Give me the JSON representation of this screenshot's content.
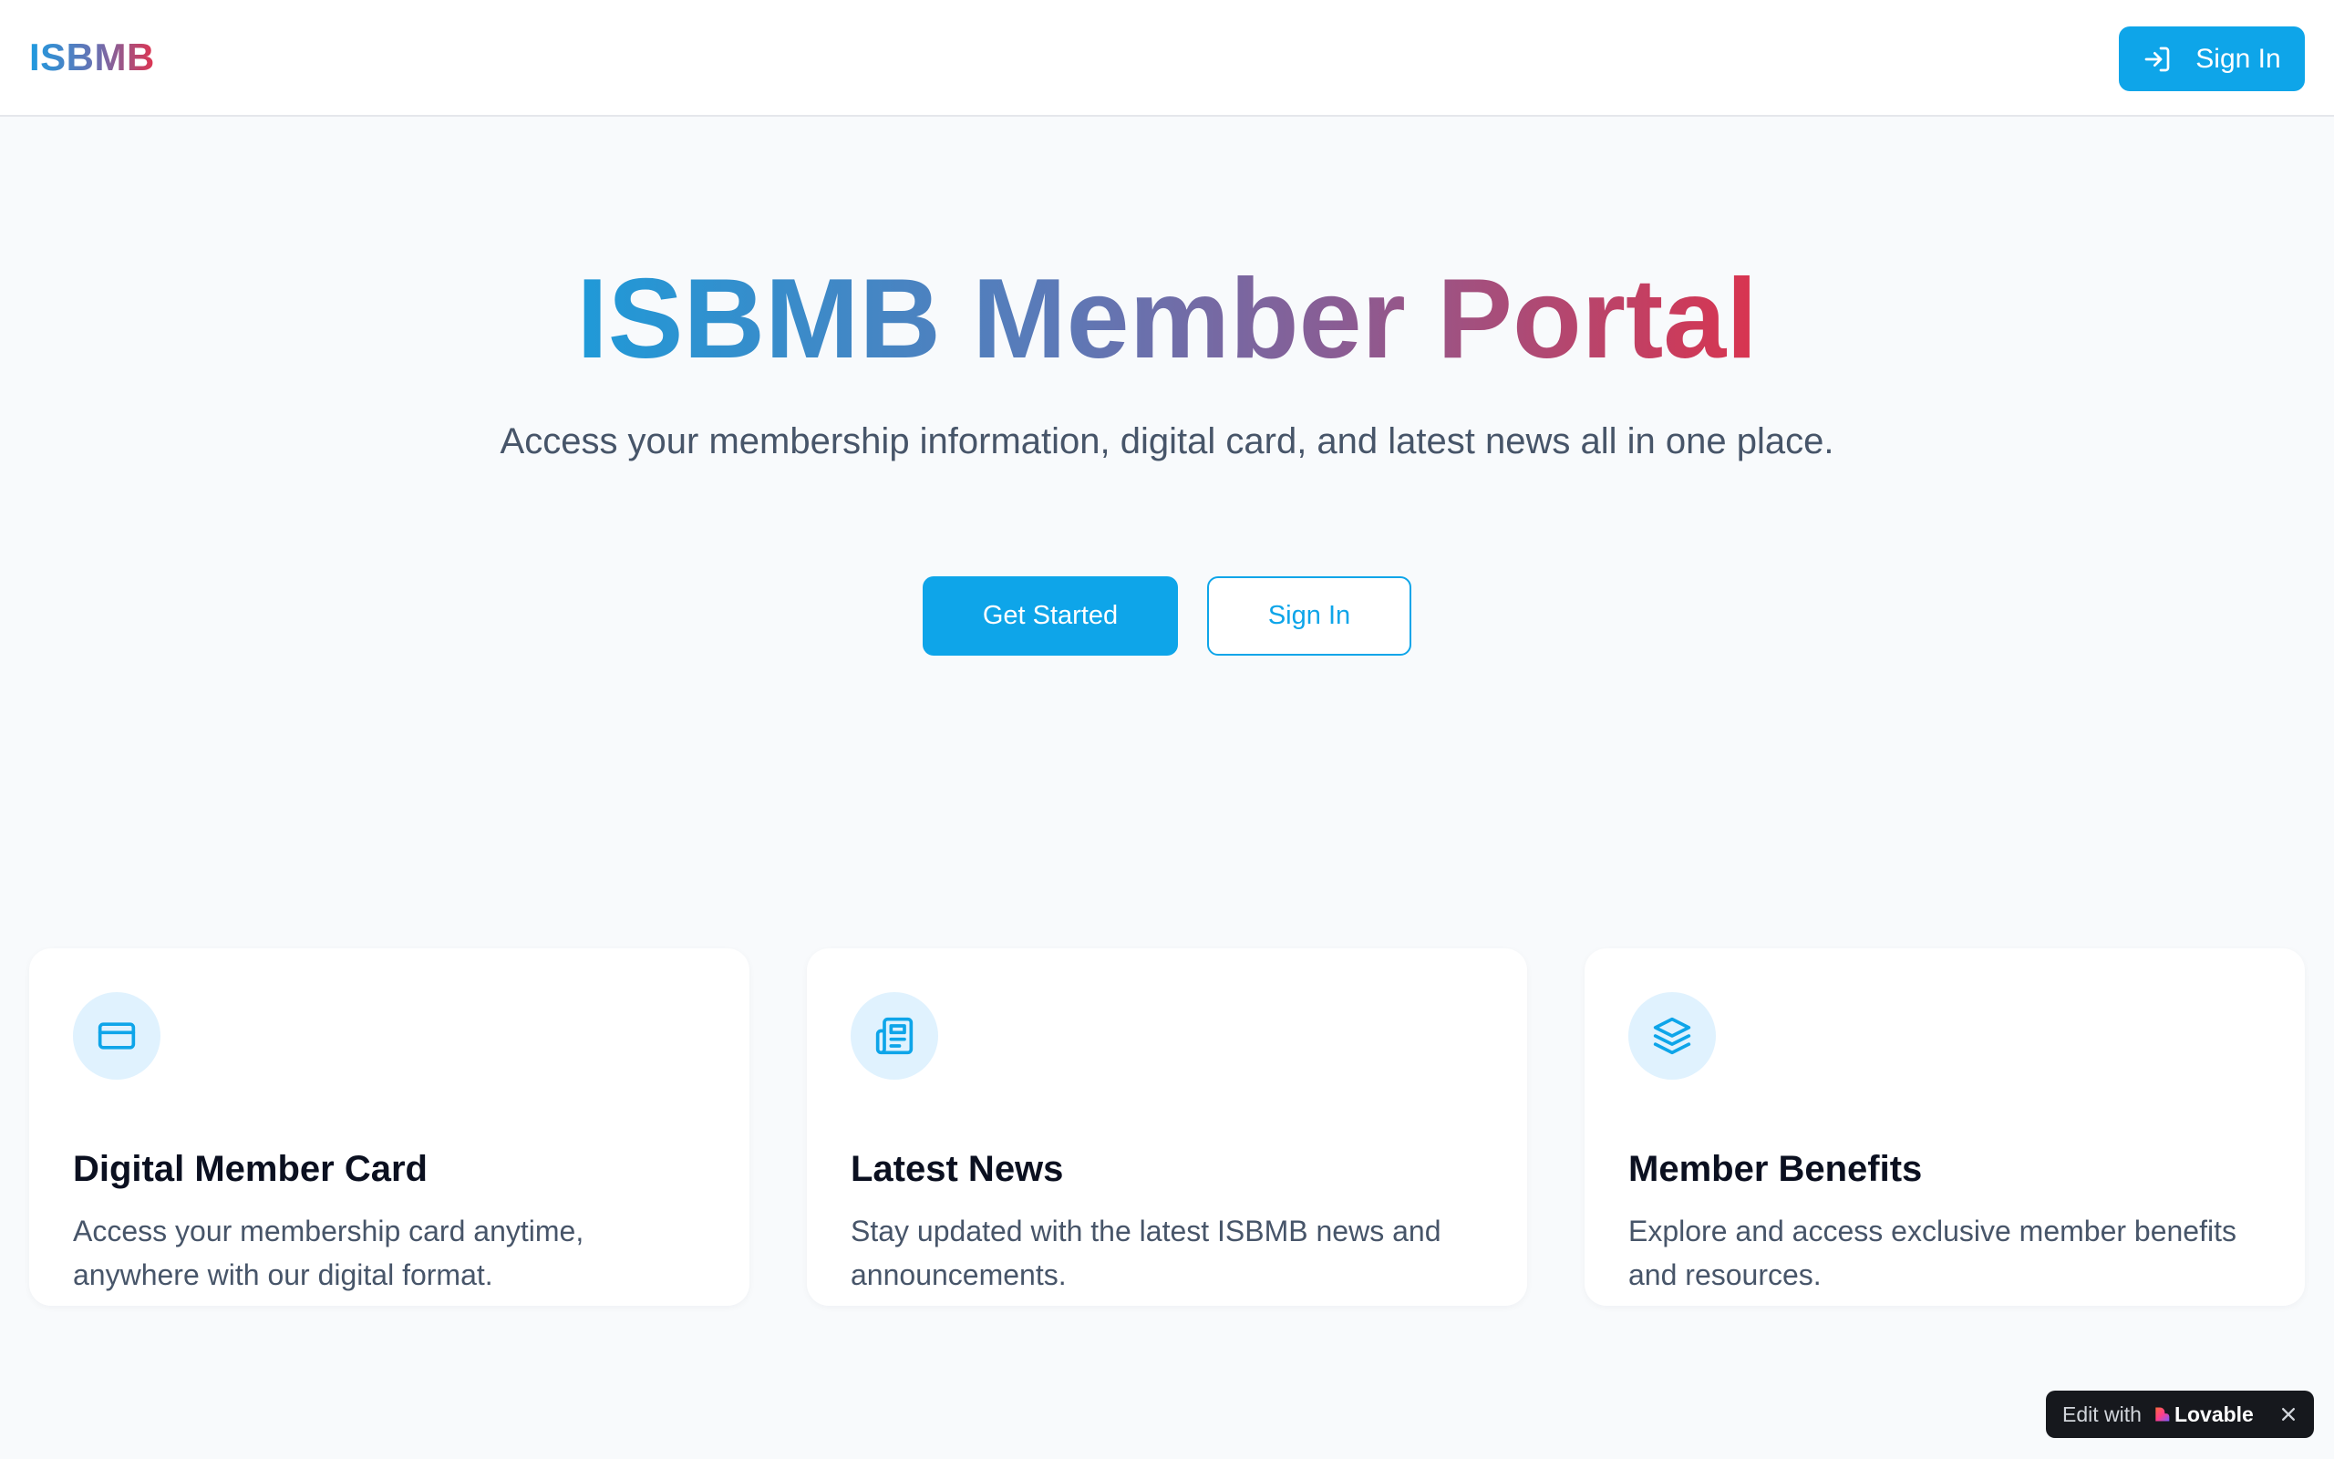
{
  "header": {
    "logo": "ISBMB",
    "sign_in_label": "Sign In"
  },
  "hero": {
    "title": "ISBMB Member Portal",
    "subtitle": "Access your membership information, digital card, and latest news all in one place.",
    "get_started_label": "Get Started",
    "sign_in_label": "Sign In"
  },
  "features": [
    {
      "icon": "credit-card-icon",
      "title": "Digital Member Card",
      "description": "Access your membership card anytime, anywhere with our digital format."
    },
    {
      "icon": "newspaper-icon",
      "title": "Latest News",
      "description": "Stay updated with the latest ISBMB news and announcements."
    },
    {
      "icon": "layers-icon",
      "title": "Member Benefits",
      "description": "Explore and access exclusive member benefits and resources."
    }
  ],
  "badge": {
    "prefix": "Edit with",
    "brand": "Lovable"
  },
  "colors": {
    "accent": "#0ea5e9",
    "gradient_start": "#1e9be0",
    "gradient_end": "#e0334f",
    "icon_bg": "#e0f2fe"
  }
}
